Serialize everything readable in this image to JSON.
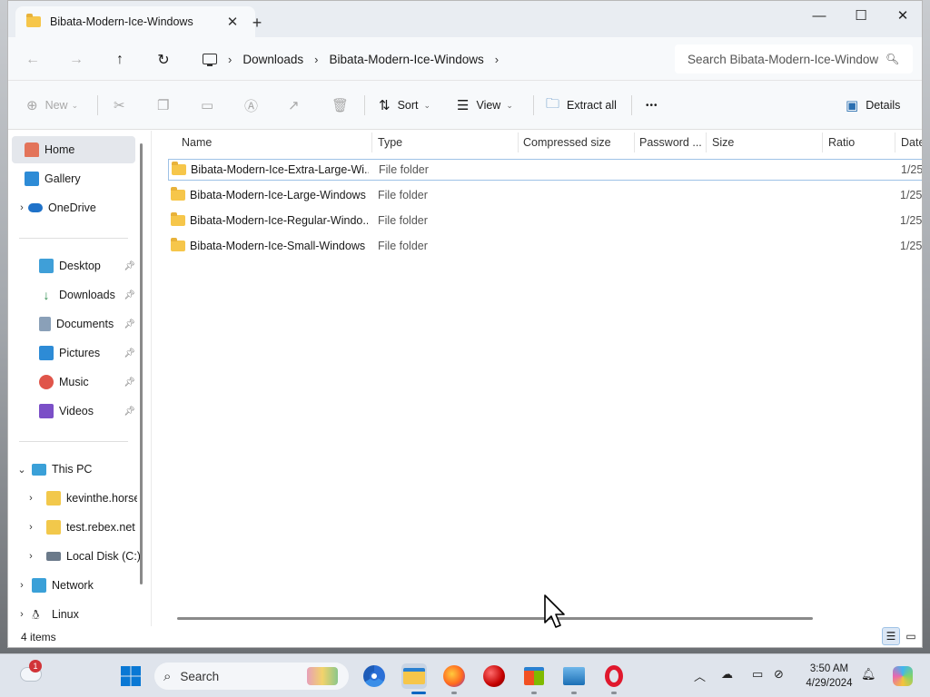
{
  "window": {
    "tab_title": "Bibata-Modern-Ice-Windows",
    "tab_close": "✕",
    "new_tab": "+",
    "minimize": "—",
    "maximize": "☐",
    "close": "✕"
  },
  "nav": {
    "back": "←",
    "forward": "→",
    "up": "↑",
    "refresh": "↻",
    "breadcrumbs": [
      "Downloads",
      "Bibata-Modern-Ice-Windows"
    ],
    "search_placeholder": "Search Bibata-Modern-Ice-Windows"
  },
  "toolbar": {
    "new_label": "New",
    "sort_label": "Sort",
    "view_label": "View",
    "extract_label": "Extract all",
    "more_label": "•••",
    "details_label": "Details"
  },
  "sidebar": {
    "items": [
      {
        "label": "Home"
      },
      {
        "label": "Gallery"
      },
      {
        "label": "OneDrive"
      },
      {
        "label": "Desktop"
      },
      {
        "label": "Downloads"
      },
      {
        "label": "Documents"
      },
      {
        "label": "Pictures"
      },
      {
        "label": "Music"
      },
      {
        "label": "Videos"
      },
      {
        "label": "This PC"
      },
      {
        "label": "kevinthe.horse"
      },
      {
        "label": "test.rebex.net"
      },
      {
        "label": "Local Disk (C:)"
      },
      {
        "label": "Network"
      },
      {
        "label": "Linux"
      }
    ]
  },
  "table": {
    "columns": [
      "Name",
      "Type",
      "Compressed size",
      "Password ...",
      "Size",
      "Ratio",
      "Date"
    ],
    "rows": [
      {
        "name": "Bibata-Modern-Ice-Extra-Large-Wi...",
        "type": "File folder",
        "date": "1/25/"
      },
      {
        "name": "Bibata-Modern-Ice-Large-Windows",
        "type": "File folder",
        "date": "1/25/"
      },
      {
        "name": "Bibata-Modern-Ice-Regular-Windo...",
        "type": "File folder",
        "date": "1/25/"
      },
      {
        "name": "Bibata-Modern-Ice-Small-Windows",
        "type": "File folder",
        "date": "1/25/"
      }
    ]
  },
  "status": {
    "items_count": "4 items"
  },
  "taskbar": {
    "search_label": "Search",
    "weather_badge": "1",
    "time": "3:50 AM",
    "date": "4/29/2024"
  },
  "colors": {
    "accent": "#0067c0",
    "folder": "#f6c64a",
    "selected_bg": "#e4e7ec"
  }
}
